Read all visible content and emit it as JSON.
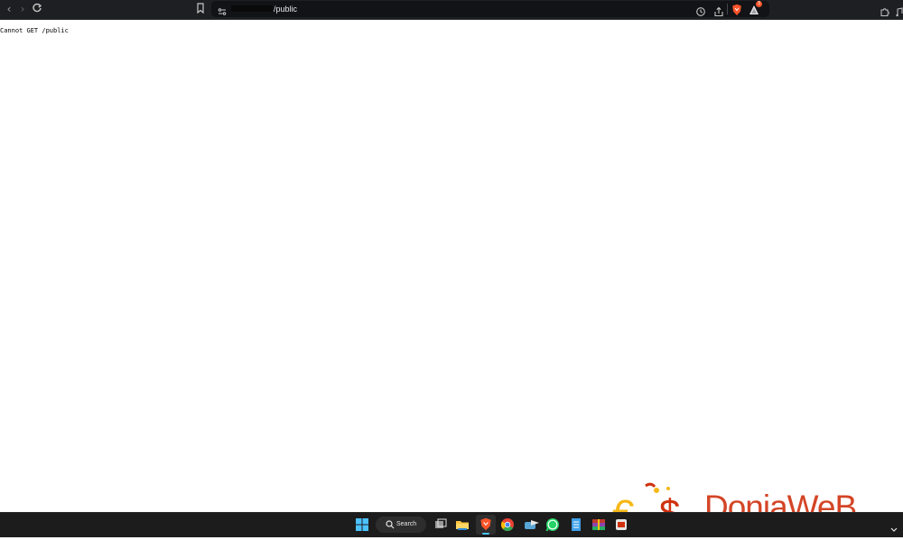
{
  "browser": {
    "url_text": "/public",
    "badge_count": "3"
  },
  "page": {
    "error_message": "Cannot GET /public"
  },
  "taskbar": {
    "search_label": "Search"
  },
  "watermark": {
    "text": "DoniaWeB"
  },
  "colors": {
    "browser_bg": "#1e1f22",
    "url_bg": "#121316",
    "taskbar_bg": "#1c1c1c",
    "brave_orange": "#fb542b",
    "watermark_red": "#d0310f",
    "watermark_yellow": "#f6b817"
  }
}
